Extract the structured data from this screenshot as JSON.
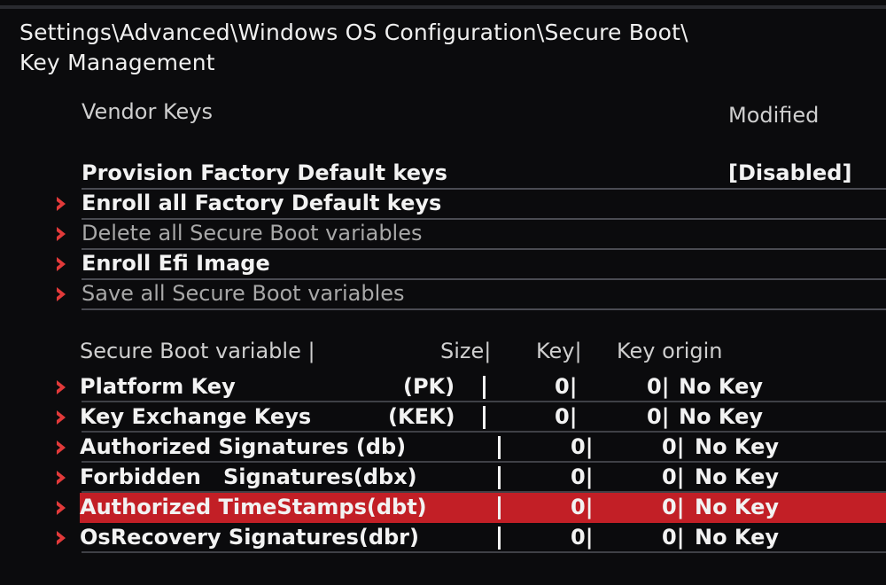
{
  "breadcrumb": {
    "line1": "Settings\\Advanced\\Windows OS Configuration\\Secure Boot\\",
    "line2": "Key Management"
  },
  "vendor_keys": {
    "label": "Vendor Keys",
    "status": "Modified"
  },
  "menu_items": [
    {
      "label": "Provision Factory Default keys",
      "value": "[Disabled]",
      "arrow": false,
      "dim": false
    },
    {
      "label": "Enroll all Factory Default keys",
      "value": "",
      "arrow": true,
      "dim": false
    },
    {
      "label": "Delete all Secure Boot variables",
      "value": "",
      "arrow": true,
      "dim": true
    },
    {
      "label": "Enroll Efi Image",
      "value": "",
      "arrow": true,
      "dim": false
    },
    {
      "label": "Save all Secure Boot variables",
      "value": "",
      "arrow": true,
      "dim": true
    }
  ],
  "table_header": {
    "variable": "Secure Boot variable |",
    "size": "Size|",
    "key": "Key|",
    "origin": "Key origin"
  },
  "variables": [
    {
      "name": "Platform Key",
      "abbr": "(PK)",
      "size": "0|",
      "key": "0|",
      "origin": "No Key",
      "selected": false
    },
    {
      "name": "Key Exchange Keys",
      "abbr": "(KEK)",
      "size": "0|",
      "key": "0|",
      "origin": "No Key",
      "selected": false
    },
    {
      "name": "Authorized Signatures (db)",
      "abbr": "",
      "size": "0|",
      "key": "0|",
      "origin": "No Key",
      "selected": false
    },
    {
      "name": "Forbidden   Signatures(dbx)",
      "abbr": "",
      "size": "0|",
      "key": "0|",
      "origin": "No Key",
      "selected": false
    },
    {
      "name": "Authorized TimeStamps(dbt)",
      "abbr": "",
      "size": "0|",
      "key": "0|",
      "origin": "No Key",
      "selected": true
    },
    {
      "name": "OsRecovery Signatures(dbr)",
      "abbr": "",
      "size": "0|",
      "key": "0|",
      "origin": "No Key",
      "selected": false
    }
  ],
  "icons": {
    "arrow": "chevron-right-icon"
  },
  "colors": {
    "accent": "#c21f26",
    "arrow": "#e23a3a",
    "background": "#0b0b0d"
  }
}
